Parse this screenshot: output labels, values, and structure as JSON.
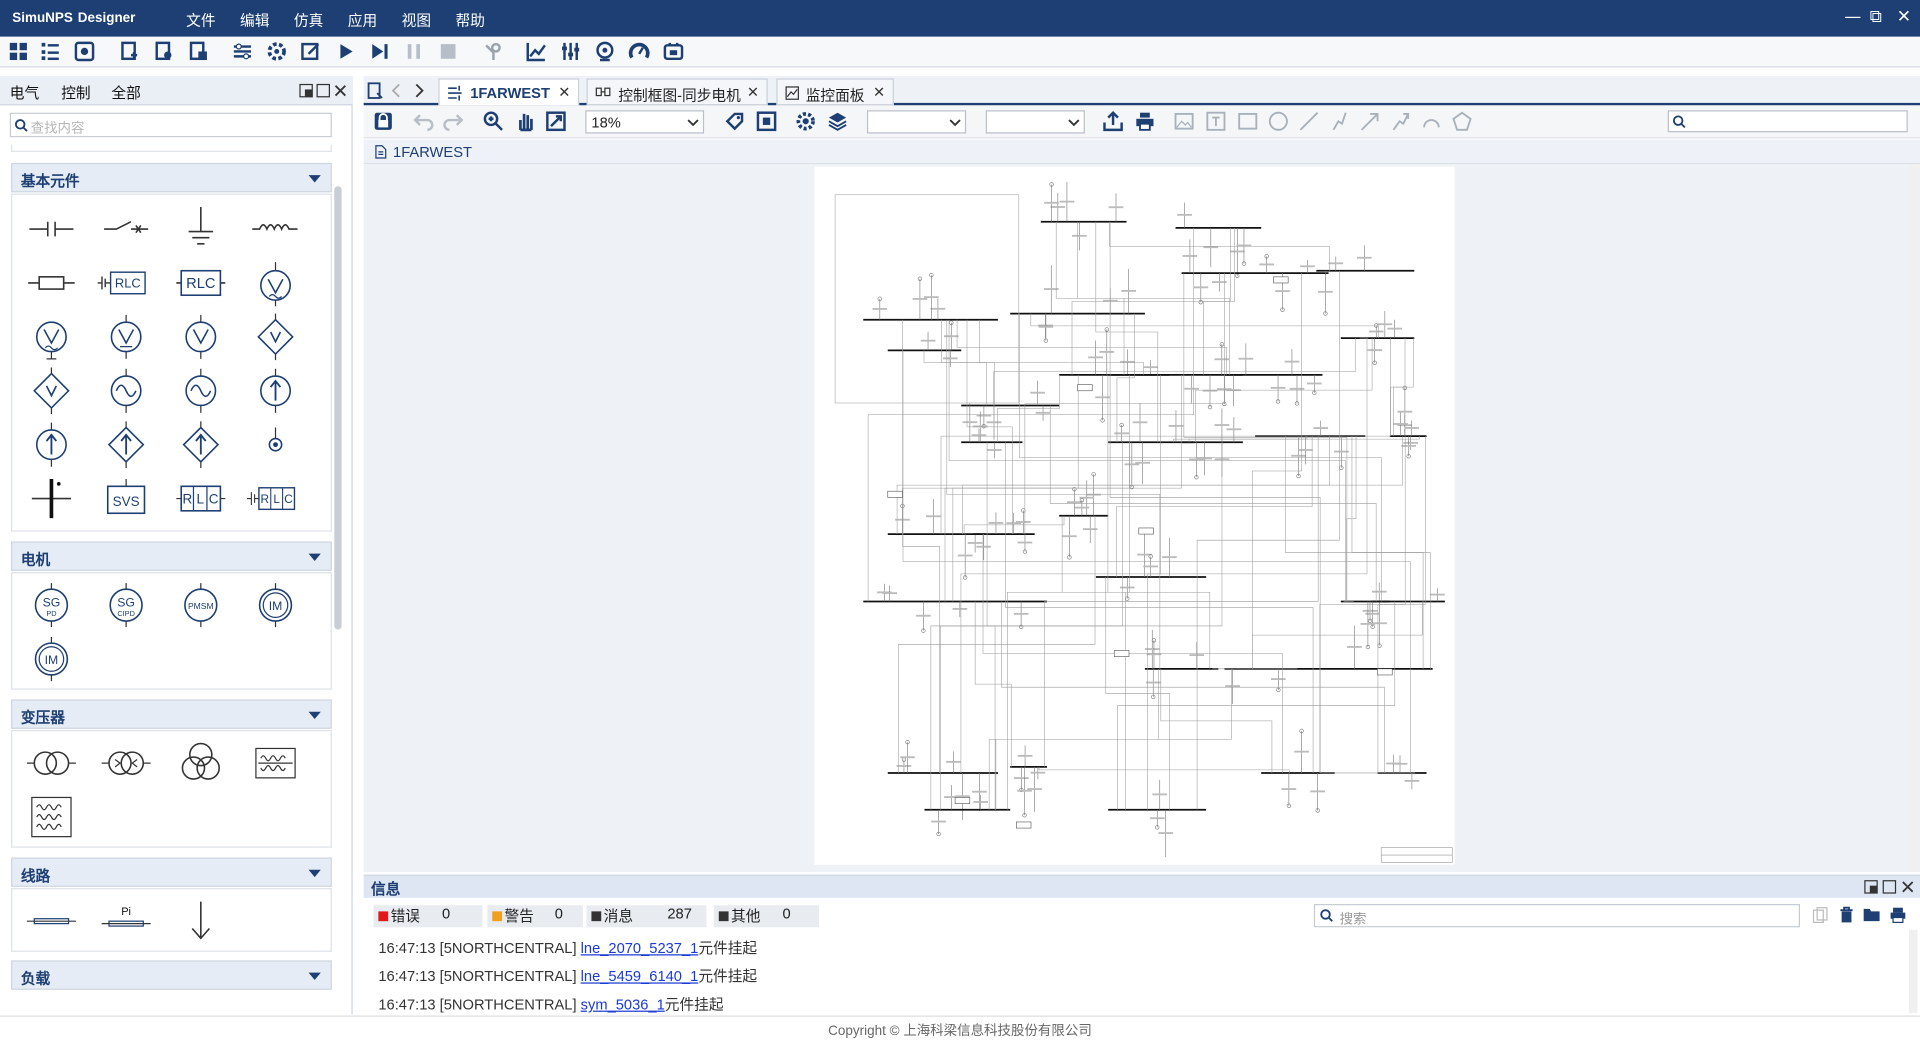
{
  "app": {
    "name": "SimuNPS",
    "subtitle": "Designer"
  },
  "menu": [
    "文件",
    "编辑",
    "仿真",
    "应用",
    "视图",
    "帮助"
  ],
  "window_controls": {
    "minimize": "—",
    "restore": "⧉",
    "close": "✕"
  },
  "left_panel": {
    "tabs": [
      "电气",
      "控制",
      "全部"
    ],
    "search_placeholder": "查找内容",
    "sections": [
      {
        "title": "基本元件"
      },
      {
        "title": "电机"
      },
      {
        "title": "变压器"
      },
      {
        "title": "线路"
      },
      {
        "title": "负载"
      }
    ],
    "labels": {
      "rlc": "RLC",
      "svs": "SVS",
      "sg_pd": "SG",
      "sg_pd_sub": "PD",
      "sg_cipd": "SG",
      "sg_cipd_sub": "CIPD",
      "pmsm": "PMSM",
      "im": "IM",
      "pi": "Pi",
      "r": "R",
      "l": "L",
      "c": "C"
    }
  },
  "doc_tabs": [
    {
      "label": "1FARWEST",
      "active": true
    },
    {
      "label": "控制框图-同步电机",
      "active": false
    },
    {
      "label": "监控面板",
      "active": false
    }
  ],
  "zoom": "18%",
  "breadcrumb": "1FARWEST",
  "info": {
    "title": "信息",
    "filters": [
      {
        "label": "错误",
        "count": "0",
        "color": "#e11818"
      },
      {
        "label": "警告",
        "count": "0",
        "color": "#f0a020"
      },
      {
        "label": "消息",
        "count": "287",
        "color": "#333333"
      },
      {
        "label": "其他",
        "count": "0",
        "color": "#333333"
      }
    ],
    "search_placeholder": "搜索",
    "logs": [
      {
        "time": "16:47:13 [5NORTHCENTRAL]",
        "link": "lne_2070_5237_1",
        "msg": "元件挂起"
      },
      {
        "time": "16:47:13 [5NORTHCENTRAL]",
        "link": "lne_5459_6140_1",
        "msg": "元件挂起"
      },
      {
        "time": "16:47:13 [5NORTHCENTRAL]",
        "link": "sym_5036_1",
        "msg": "元件挂起"
      }
    ]
  },
  "footer": "Copyright © 上海科梁信息科技股份有限公司"
}
